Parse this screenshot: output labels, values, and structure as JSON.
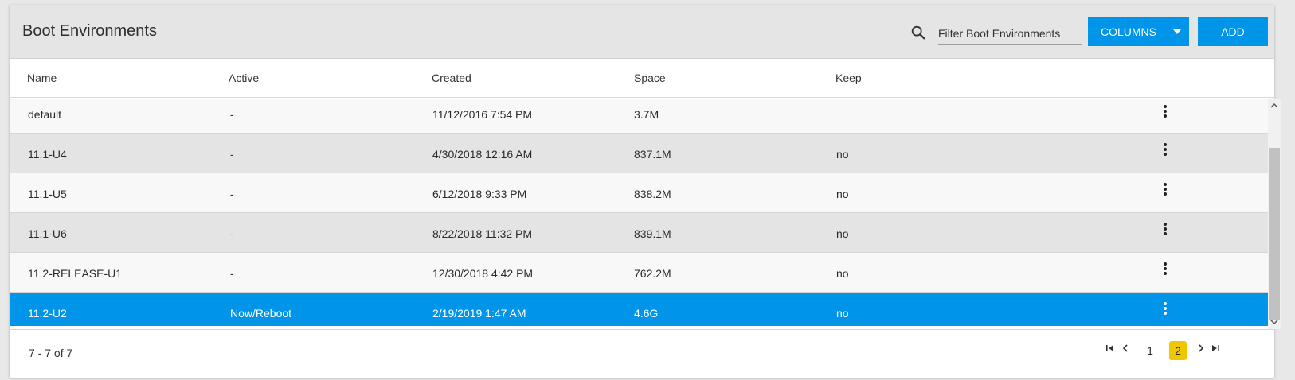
{
  "header": {
    "title": "Boot Environments",
    "filter_placeholder": "Filter Boot Environments",
    "columns_label": "COLUMNS",
    "add_label": "ADD"
  },
  "table": {
    "columns": [
      "Name",
      "Active",
      "Created",
      "Space",
      "Keep"
    ],
    "rows": [
      {
        "name": "default",
        "active": "-",
        "created": "11/12/2016 7:54 PM",
        "space": "3.7M",
        "keep": ""
      },
      {
        "name": "11.1-U4",
        "active": "-",
        "created": "4/30/2018 12:16 AM",
        "space": "837.1M",
        "keep": "no"
      },
      {
        "name": "11.1-U5",
        "active": "-",
        "created": "6/12/2018 9:33 PM",
        "space": "838.2M",
        "keep": "no"
      },
      {
        "name": "11.1-U6",
        "active": "-",
        "created": "8/22/2018 11:32 PM",
        "space": "839.1M",
        "keep": "no"
      },
      {
        "name": "11.2-RELEASE-U1",
        "active": "-",
        "created": "12/30/2018 4:42 PM",
        "space": "762.2M",
        "keep": "no"
      },
      {
        "name": "11.2-U2",
        "active": "Now/Reboot",
        "created": "2/19/2019 1:47 AM",
        "space": "4.6G",
        "keep": "no"
      }
    ]
  },
  "footer": {
    "range_text": "7 - 7 of 7",
    "pages": [
      "1",
      "2"
    ],
    "current_page": "2"
  },
  "colors": {
    "accent": "#0095e9",
    "current_page": "#f0c800",
    "header_bg": "#e5e5e5",
    "row_alt": "#e4e4e4"
  },
  "icons": {
    "search": "search-icon",
    "row_menu": "more-vert-icon",
    "first_page": "first-page-icon",
    "prev_page": "chevron-left-icon",
    "next_page": "chevron-right-icon",
    "last_page": "last-page-icon"
  }
}
